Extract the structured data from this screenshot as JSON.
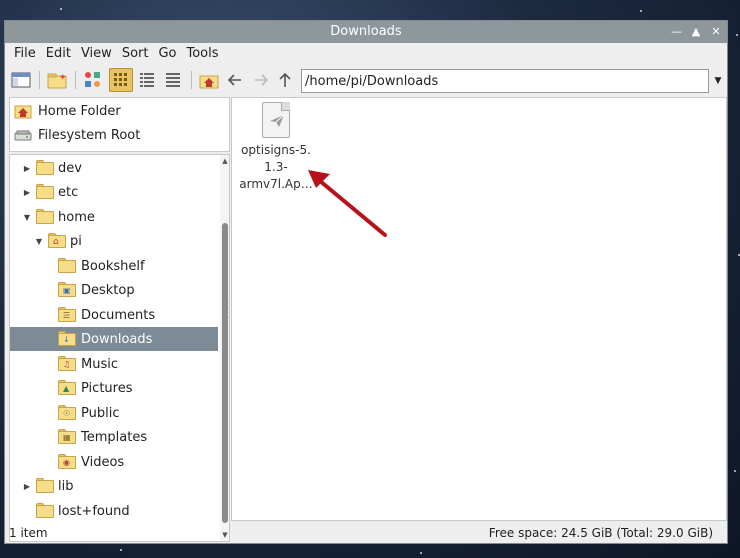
{
  "window": {
    "title": "Downloads"
  },
  "menu": [
    "File",
    "Edit",
    "View",
    "Sort",
    "Go",
    "Tools"
  ],
  "path": {
    "value": "/home/pi/Downloads"
  },
  "places": [
    {
      "label": "Home Folder",
      "icon": "home-icon"
    },
    {
      "label": "Filesystem Root",
      "icon": "drive-icon"
    }
  ],
  "tree": [
    {
      "label": "dev",
      "level": 0,
      "expander": "collapsed"
    },
    {
      "label": "etc",
      "level": 0,
      "expander": "collapsed"
    },
    {
      "label": "home",
      "level": 0,
      "expander": "expanded"
    },
    {
      "label": "pi",
      "level": 1,
      "expander": "expanded",
      "icon": "home"
    },
    {
      "label": "Bookshelf",
      "level": 2,
      "expander": "none"
    },
    {
      "label": "Desktop",
      "level": 2,
      "expander": "none",
      "icon": "desktop"
    },
    {
      "label": "Documents",
      "level": 2,
      "expander": "none",
      "icon": "documents"
    },
    {
      "label": "Downloads",
      "level": 2,
      "expander": "none",
      "icon": "downloads",
      "selected": true
    },
    {
      "label": "Music",
      "level": 2,
      "expander": "none",
      "icon": "music"
    },
    {
      "label": "Pictures",
      "level": 2,
      "expander": "none",
      "icon": "pictures"
    },
    {
      "label": "Public",
      "level": 2,
      "expander": "none",
      "icon": "public"
    },
    {
      "label": "Templates",
      "level": 2,
      "expander": "none",
      "icon": "templates"
    },
    {
      "label": "Videos",
      "level": 2,
      "expander": "none",
      "icon": "videos"
    },
    {
      "label": "lib",
      "level": 0,
      "expander": "collapsed"
    },
    {
      "label": "lost+found",
      "level": 0,
      "expander": "none"
    }
  ],
  "files": [
    {
      "name_line1": "optisigns-5.",
      "name_line2": "1.3-",
      "name_line3": "armv7l.Ap…",
      "icon": "file-icon"
    }
  ],
  "status": {
    "count": "1 item",
    "free_space": "Free space: 24.5 GiB (Total: 29.0 GiB)"
  },
  "colors": {
    "selection": "#7c8b95",
    "titlebar": "#8e979c",
    "annotation_arrow": "#b5121b"
  }
}
